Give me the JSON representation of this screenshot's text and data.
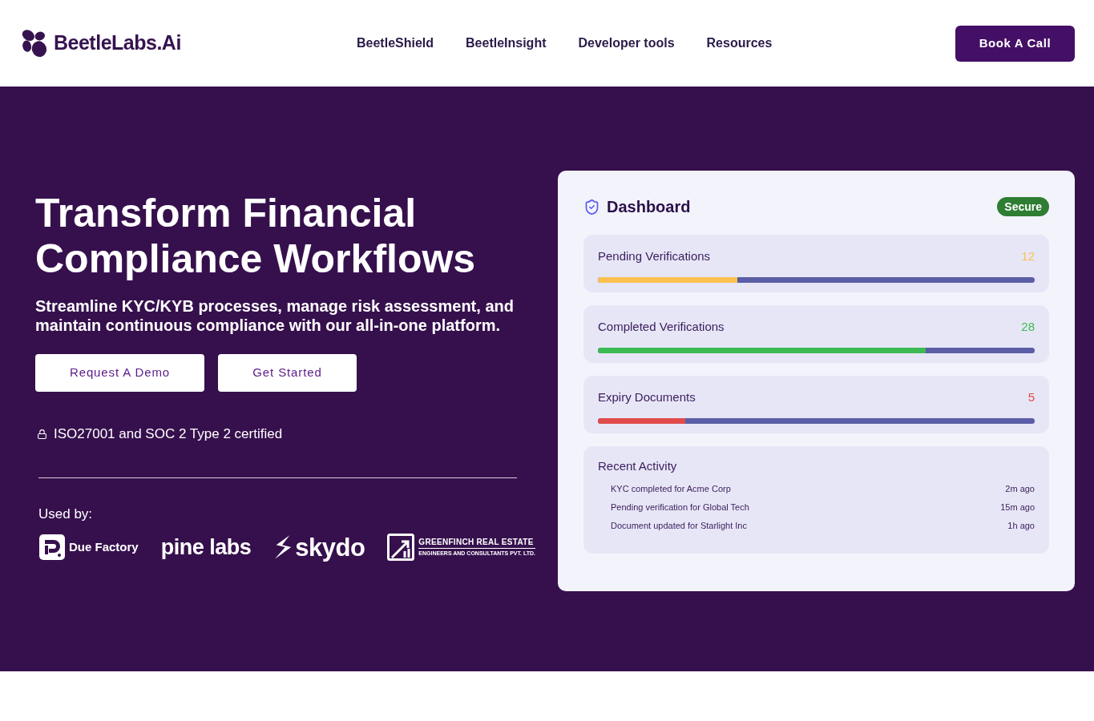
{
  "header": {
    "logo": "BeetleLabs.Ai",
    "nav": [
      "BeetleShield",
      "BeetleInsight",
      "Developer tools",
      "Resources"
    ],
    "cta": "Book A Call"
  },
  "hero": {
    "title": "Transform Financial Compliance Workflows",
    "subtitle": "Streamline KYC/KYB processes, manage risk assessment, and maintain continuous compliance with our all-in-one platform.",
    "buttons": [
      "Request A Demo",
      "Get Started"
    ],
    "certification": "ISO27001 and SOC 2 Type 2 certified",
    "used_by_label": "Used by:",
    "clients": [
      {
        "kind": "due",
        "name": "Due Factory"
      },
      {
        "kind": "pine",
        "name": "pine labs"
      },
      {
        "kind": "skydo",
        "name": "skydo"
      },
      {
        "kind": "greenfinch",
        "name": "GREENFINCH REAL ESTATE",
        "tagline": "ENGINEERS AND CONSULTANTS PVT. LTD."
      }
    ]
  },
  "dashboard": {
    "title": "Dashboard",
    "badge": "Secure",
    "metrics": [
      {
        "label": "Pending Verifications",
        "value": "12",
        "level": 0.32,
        "color": "#fbc14f"
      },
      {
        "label": "Completed Verifications",
        "value": "28",
        "level": 0.75,
        "color": "#3cba54"
      },
      {
        "label": "Expiry Documents",
        "value": "5",
        "level": 0.2,
        "color": "#e04b4b"
      }
    ],
    "recent_activity": {
      "title": "Recent Activity",
      "items": [
        {
          "text": "KYC completed for Acme Corp",
          "time": "2m ago"
        },
        {
          "text": "Pending verification for Global Tech",
          "time": "15m ago"
        },
        {
          "text": "Document updated for Starlight Inc",
          "time": "1h ago"
        }
      ]
    }
  }
}
